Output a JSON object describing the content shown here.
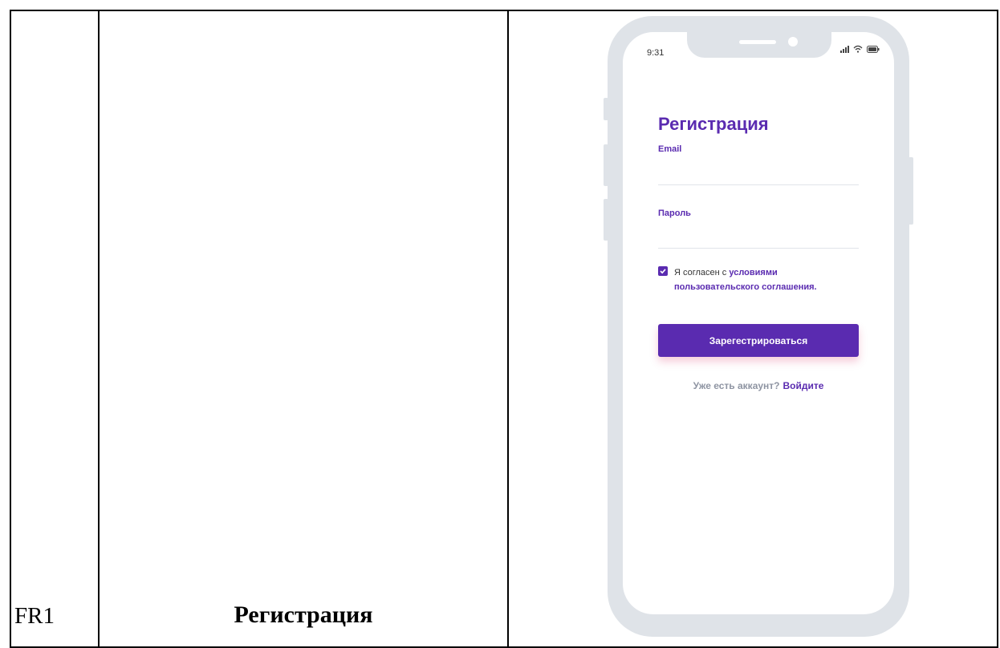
{
  "table": {
    "row_id": "FR1",
    "row_name": "Регистрация"
  },
  "phone": {
    "status_time": "9:31",
    "title": "Регистрация",
    "email_label": "Email",
    "email_value": "",
    "password_label": "Пароль",
    "password_value": "",
    "agree_checked": true,
    "agree_text": "Я согласен с ",
    "agree_link": "условиями пользовательского соглашения.",
    "register_button": "Зарегестрироваться",
    "login_prompt": "Уже есть аккаунт?",
    "login_link": "Войдите"
  },
  "colors": {
    "accent": "#5a2bb0",
    "frame": "#dfe3e8"
  },
  "icons": [
    "signal-icon",
    "wifi-icon",
    "battery-icon",
    "checkmark-icon"
  ]
}
